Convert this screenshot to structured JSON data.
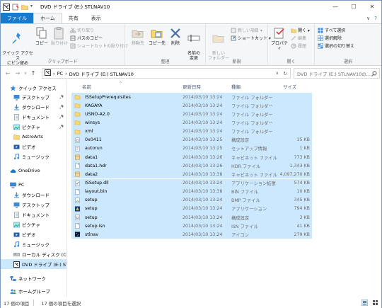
{
  "window": {
    "title": "DVD ドライブ (E:) STLNAV10",
    "controls": {
      "minimize": "—",
      "maximize": "☐",
      "close": "✕"
    }
  },
  "tabs": [
    "ファイル",
    "ホーム",
    "共有",
    "表示"
  ],
  "tab_right": {
    "collapse": "∨",
    "help": "?"
  },
  "ribbon": {
    "clipboard": {
      "pin": "クイック アクセス\nにピン留め",
      "copy": "コピー",
      "paste": "貼り付け",
      "cut": "切り取り",
      "copy_path": "パスのコピー",
      "paste_shortcut": "ショートカットの貼り付け",
      "label": "クリップボード"
    },
    "organize": {
      "move_to": "移動先",
      "copy_to": "コピー先",
      "delete": "削除",
      "rename": "名前の\n変更",
      "label": "整理"
    },
    "new": {
      "new_folder": "新しい\nフォルダー",
      "new_item": "新しい項目 ▾",
      "shortcut": "ショートカット ▾",
      "label": "新規"
    },
    "open": {
      "properties": "プロパティ",
      "open": "開く ▾",
      "edit": "編集",
      "history": "履歴",
      "label": "開く"
    },
    "select": {
      "select_all": "すべて選択",
      "select_none": "選択解除",
      "invert": "選択の切り替え",
      "label": "選択"
    }
  },
  "address": {
    "back": "←",
    "forward": "→",
    "up_arrow": "∨",
    "up": "↑",
    "crumbs": [
      "PC",
      "DVD ドライブ (E:) STLNAV10"
    ],
    "sep": "›",
    "dropdown": "∨",
    "refresh": "↻",
    "search_placeholder": "DVD ドライブ (E:) STLNAV10の..."
  },
  "nav": {
    "items": [
      {
        "label": "クイック アクセス",
        "icon": "star-icon",
        "level": 0,
        "pinned": false
      },
      {
        "label": "デスクトップ",
        "icon": "desktop-icon",
        "level": 1,
        "pinned": true
      },
      {
        "label": "ダウンロード",
        "icon": "download-icon",
        "level": 1,
        "pinned": true
      },
      {
        "label": "ドキュメント",
        "icon": "document-icon",
        "level": 1,
        "pinned": true
      },
      {
        "label": "ピクチャ",
        "icon": "picture-icon",
        "level": 1,
        "pinned": true
      },
      {
        "label": "AstroArts",
        "icon": "folder-icon",
        "level": 1,
        "pinned": false
      },
      {
        "label": "ビデオ",
        "icon": "video-icon",
        "level": 1,
        "pinned": false
      },
      {
        "label": "ミュージック",
        "icon": "music-icon",
        "level": 1,
        "pinned": false
      },
      {
        "label": "OneDrive",
        "icon": "cloud-icon",
        "level": 0,
        "pinned": false
      },
      {
        "label": "PC",
        "icon": "pc-icon",
        "level": 0,
        "pinned": false
      },
      {
        "label": "ダウンロード",
        "icon": "download-icon",
        "level": 1,
        "pinned": false
      },
      {
        "label": "デスクトップ",
        "icon": "desktop-icon",
        "level": 1,
        "pinned": false
      },
      {
        "label": "ドキュメント",
        "icon": "document-icon",
        "level": 1,
        "pinned": false
      },
      {
        "label": "ピクチャ",
        "icon": "picture-icon",
        "level": 1,
        "pinned": false
      },
      {
        "label": "ビデオ",
        "icon": "video-icon",
        "level": 1,
        "pinned": false
      },
      {
        "label": "ミュージック",
        "icon": "music-icon",
        "level": 1,
        "pinned": false
      },
      {
        "label": "ローカル ディスク (C:)",
        "icon": "disk-icon",
        "level": 1,
        "pinned": false
      },
      {
        "label": "DVD ドライブ (E:) STLI",
        "icon": "dvd-icon",
        "level": 1,
        "pinned": false,
        "selected": true
      },
      {
        "label": "ネットワーク",
        "icon": "network-icon",
        "level": 0,
        "pinned": false
      },
      {
        "label": "ホームグループ",
        "icon": "homegroup-icon",
        "level": 0,
        "pinned": false
      }
    ],
    "pin_glyph": "📌"
  },
  "columns": {
    "name": "名前",
    "date": "更新日時",
    "type": "種類",
    "size": "サイズ",
    "sort_arrow": "^"
  },
  "files": [
    {
      "name": "ISSetupPrerequisites",
      "date": "2014/03/10 13:24",
      "type": "ファイル フォルダー",
      "size": "",
      "icon": "folder-icon"
    },
    {
      "name": "KAGAYA",
      "date": "2014/03/10 13:24",
      "type": "ファイル フォルダー",
      "size": "",
      "icon": "folder-icon"
    },
    {
      "name": "USNO-A2.0",
      "date": "2014/03/10 13:24",
      "type": "ファイル フォルダー",
      "size": "",
      "icon": "folder-icon"
    },
    {
      "name": "winsys",
      "date": "2014/03/10 13:24",
      "type": "ファイル フォルダー",
      "size": "",
      "icon": "folder-icon"
    },
    {
      "name": "xml",
      "date": "2014/03/10 13:24",
      "type": "ファイル フォルダー",
      "size": "",
      "icon": "folder-icon"
    },
    {
      "name": "0x0411",
      "date": "2014/03/10 13:25",
      "type": "構成設定",
      "size": "15 KB",
      "icon": "settings-file-icon"
    },
    {
      "name": "autorun",
      "date": "2014/03/10 13:25",
      "type": "セットアップ情報",
      "size": "1 KB",
      "icon": "setup-info-icon"
    },
    {
      "name": "data1",
      "date": "2014/03/10 13:26",
      "type": "キャビネット ファイル",
      "size": "773 KB",
      "icon": "cabinet-icon"
    },
    {
      "name": "data1.hdr",
      "date": "2014/03/10 13:26",
      "type": "HDR ファイル",
      "size": "1,343 KB",
      "icon": "file-icon"
    },
    {
      "name": "data2",
      "date": "2014/03/10 13:38",
      "type": "キャビネット ファイル",
      "size": "4,097,270 KB",
      "icon": "cabinet-icon"
    },
    {
      "name": "ISSetup.dll",
      "date": "2014/03/10 13:24",
      "type": "アプリケーション拡張",
      "size": "574 KB",
      "icon": "dll-icon"
    },
    {
      "name": "layout.bin",
      "date": "2014/03/10 13:38",
      "type": "BIN ファイル",
      "size": "10 KB",
      "icon": "file-icon"
    },
    {
      "name": "setup",
      "date": "2014/03/10 13:24",
      "type": "BMP ファイル",
      "size": "345 KB",
      "icon": "bmp-icon"
    },
    {
      "name": "setup",
      "date": "2014/03/10 13:24",
      "type": "アプリケーション",
      "size": "794 KB",
      "icon": "app-icon"
    },
    {
      "name": "setup",
      "date": "2014/03/10 13:24",
      "type": "構成設定",
      "size": "3 KB",
      "icon": "settings-file-icon"
    },
    {
      "name": "setup.isn",
      "date": "2014/03/10 13:24",
      "type": "ISN ファイル",
      "size": "41 KB",
      "icon": "file-icon"
    },
    {
      "name": "stlnav",
      "date": "2014/03/10 13:24",
      "type": "アイコン",
      "size": "279 KB",
      "icon": "stlnav-icon"
    }
  ],
  "status": {
    "count": "17 個の項目",
    "selected": "17 個の項目を選択"
  },
  "colors": {
    "accent": "#1979ca",
    "selection": "#cce8ff",
    "folder": "#f8d775"
  }
}
